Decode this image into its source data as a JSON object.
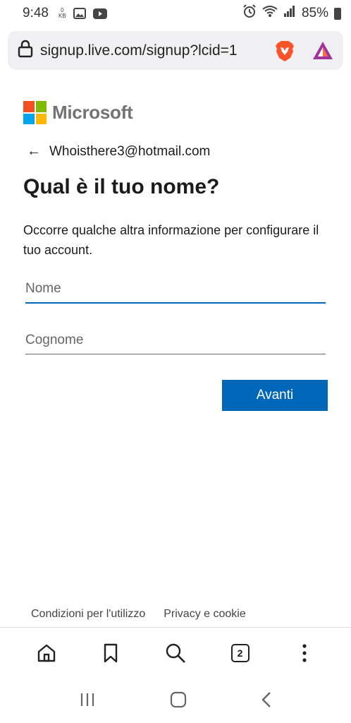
{
  "status_bar": {
    "time": "9:48",
    "data_rate_value": "0",
    "data_rate_unit": "KB",
    "battery_percent": "85%"
  },
  "address_bar": {
    "url": "signup.live.com/signup?lcid=1"
  },
  "brand": {
    "name": "Microsoft",
    "colors": [
      "#f25022",
      "#7fba00",
      "#00a4ef",
      "#ffb900"
    ]
  },
  "account": {
    "email": "Whoisthere3@hotmail.com"
  },
  "form": {
    "title": "Qual è il tuo nome?",
    "description": "Occorre qualche altra informazione per configurare il tuo account.",
    "first_name_placeholder": "Nome",
    "last_name_placeholder": "Cognome",
    "next_label": "Avanti"
  },
  "footer": {
    "terms": "Condizioni per l'utilizzo",
    "privacy": "Privacy e cookie"
  },
  "browser_toolbar": {
    "tab_count": "2"
  },
  "colors": {
    "accent": "#0067b8"
  }
}
